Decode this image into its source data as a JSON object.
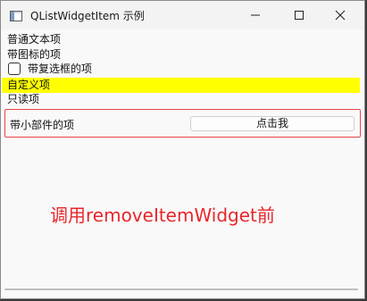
{
  "window": {
    "title": "QListWidgetItem 示例"
  },
  "list": {
    "items": [
      {
        "label": "普通文本项"
      },
      {
        "label": "带图标的项"
      },
      {
        "label": "带复选框的项",
        "checked": false
      },
      {
        "label": "自定义项",
        "background": "#ffff00"
      },
      {
        "label": "只读项"
      }
    ],
    "widget_item": {
      "label": "带小部件的项",
      "button_label": "点击我"
    }
  },
  "caption": "调用removeItemWidget前",
  "colors": {
    "highlight_border": "#e54646",
    "caption_text": "#e8262a",
    "custom_item_bg": "#ffff00"
  }
}
